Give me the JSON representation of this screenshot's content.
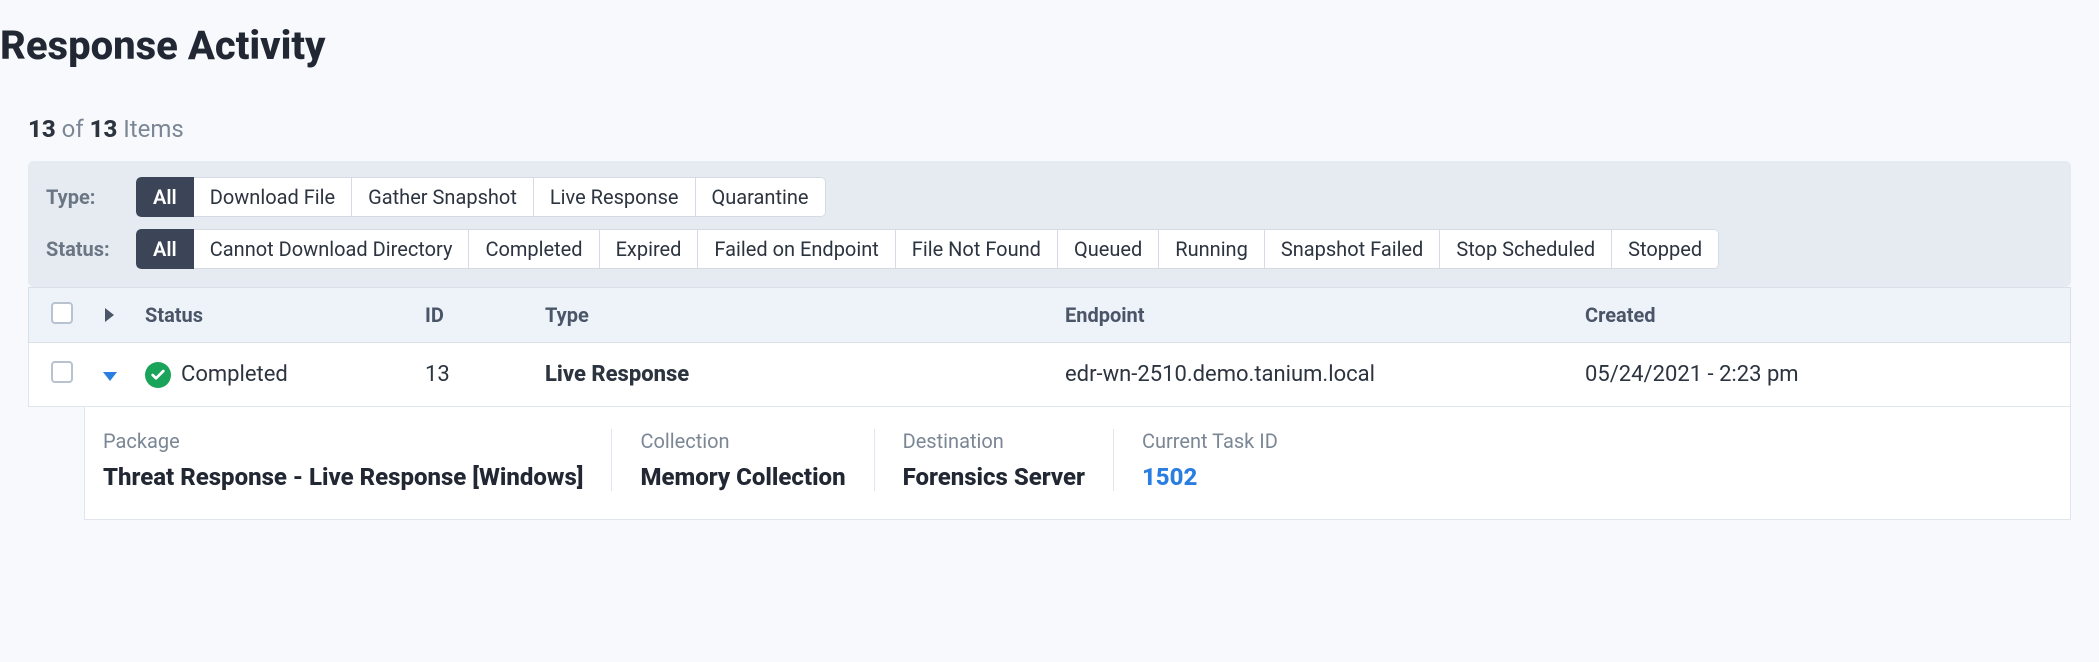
{
  "title": "Response Activity",
  "count": {
    "shown": "13",
    "of_word": "of",
    "total": "13",
    "items_word": "Items"
  },
  "filters": {
    "type_label": "Type:",
    "status_label": "Status:",
    "types": [
      "All",
      "Download File",
      "Gather Snapshot",
      "Live Response",
      "Quarantine"
    ],
    "type_active": 0,
    "statuses": [
      "All",
      "Cannot Download Directory",
      "Completed",
      "Expired",
      "Failed on Endpoint",
      "File Not Found",
      "Queued",
      "Running",
      "Snapshot Failed",
      "Stop Scheduled",
      "Stopped"
    ],
    "status_active": 0
  },
  "columns": {
    "status": "Status",
    "id": "ID",
    "type": "Type",
    "endpoint": "Endpoint",
    "created": "Created"
  },
  "row": {
    "status": "Completed",
    "id": "13",
    "type": "Live Response",
    "endpoint": "edr-wn-2510.demo.tanium.local",
    "created": "05/24/2021 - 2:23 pm"
  },
  "details": {
    "package_label": "Package",
    "package_value": "Threat Response - Live Response [Windows]",
    "collection_label": "Collection",
    "collection_value": "Memory Collection",
    "destination_label": "Destination",
    "destination_value": "Forensics Server",
    "task_label": "Current Task ID",
    "task_value": "1502"
  }
}
